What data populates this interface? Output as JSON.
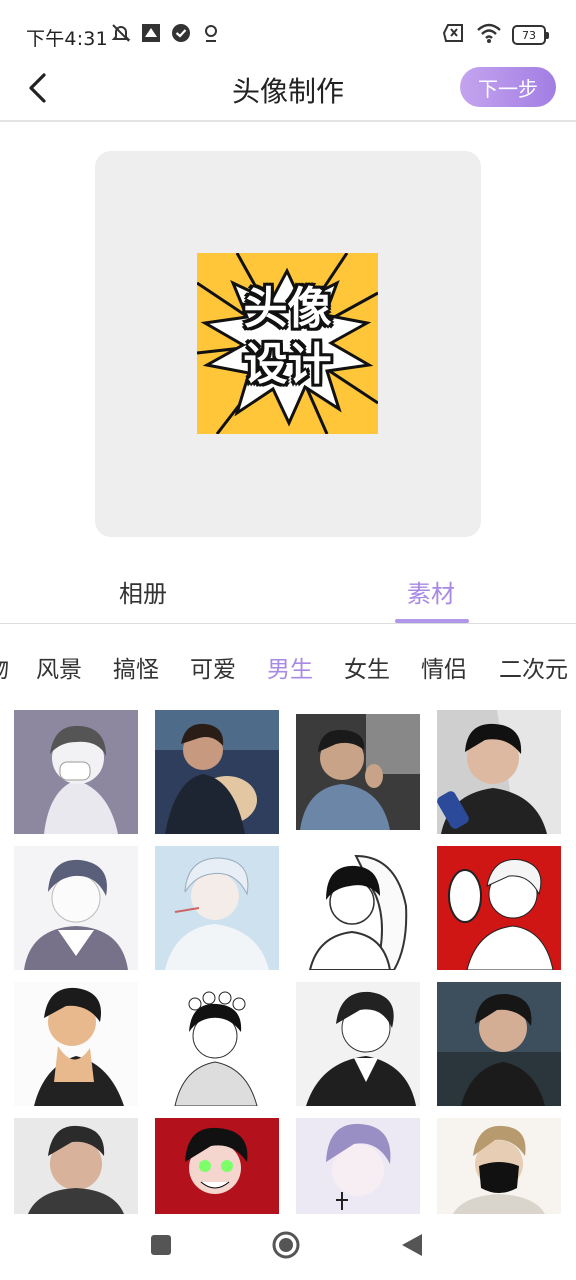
{
  "status_bar": {
    "time": "下午4:31",
    "battery": "73"
  },
  "header": {
    "title": "头像制作",
    "next_label": "下一步"
  },
  "preview": {
    "line1": "头像",
    "line2": "设计",
    "background_color": "#ffc63a"
  },
  "main_tabs": [
    {
      "label": "相册",
      "active": false
    },
    {
      "label": "素材",
      "active": true
    }
  ],
  "categories": [
    {
      "label": "物",
      "active": false
    },
    {
      "label": "风景",
      "active": false
    },
    {
      "label": "搞怪",
      "active": false
    },
    {
      "label": "可爱",
      "active": false
    },
    {
      "label": "男生",
      "active": true
    },
    {
      "label": "女生",
      "active": false
    },
    {
      "label": "情侣",
      "active": false
    },
    {
      "label": "二次元",
      "active": false
    }
  ],
  "thumbnails": [
    {
      "name": "anime-boy-mask-avatar"
    },
    {
      "name": "boy-with-puppy-avatar"
    },
    {
      "name": "boy-selfie-avatar"
    },
    {
      "name": "boy-drinking-avatar"
    },
    {
      "name": "anime-boy-glasses-avatar"
    },
    {
      "name": "anime-boy-silver-hair-avatar"
    },
    {
      "name": "anime-boy-hood-avatar"
    },
    {
      "name": "anime-boy-red-background-avatar"
    },
    {
      "name": "boy-sketch-avatar"
    },
    {
      "name": "anime-boy-flower-crown-avatar"
    },
    {
      "name": "anime-boy-suit-avatar"
    },
    {
      "name": "boy-profile-avatar"
    },
    {
      "name": "boy-portrait-avatar"
    },
    {
      "name": "anime-boy-red-avatar"
    },
    {
      "name": "anime-boy-lavender-avatar"
    },
    {
      "name": "boy-black-mask-avatar"
    }
  ],
  "accent_color": "#a889e4",
  "icons": {
    "back": "chevron-left-icon",
    "home": "circle-icon",
    "recents": "square-icon",
    "nav_back": "triangle-left-icon"
  }
}
